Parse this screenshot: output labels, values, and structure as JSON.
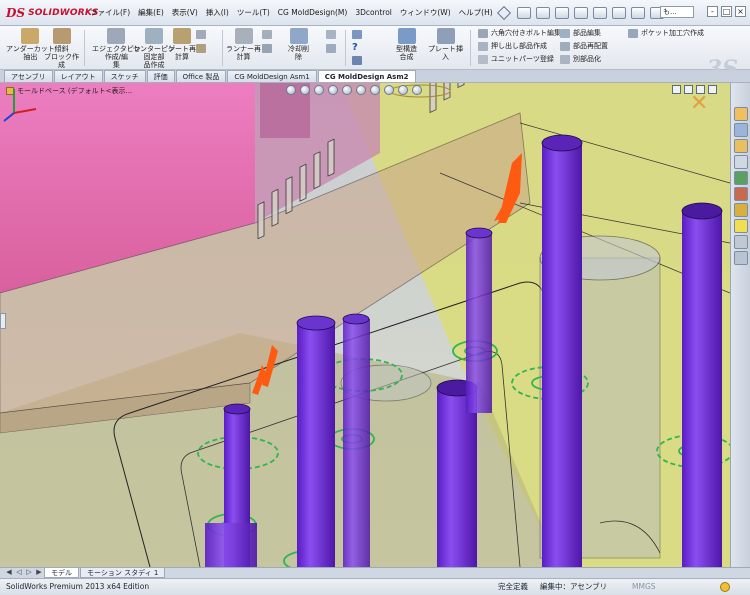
{
  "app": {
    "logo_mark": "DS",
    "logo_text": "SOLIDWORKS"
  },
  "menu": {
    "items": [
      "ファイル(F)",
      "編集(E)",
      "表示(V)",
      "挿入(I)",
      "ツール(T)",
      "CG MoldDesign(M)",
      "3Dcontrol",
      "ウィンドウ(W)",
      "ヘルプ(H)"
    ],
    "search_text": "も..."
  },
  "ribbon": {
    "buttons": [
      {
        "label": "アンダーカット\n抽出",
        "icon": "undercut-icon",
        "color": "#c9a86a"
      },
      {
        "label": "傾斜\nブロック作\n成",
        "icon": "slope-block-icon",
        "color": "#b89a70"
      },
      {
        "label": "エジェクタピン\n作成/編\n集",
        "icon": "ejector-pin-icon",
        "color": "#9fa8b8"
      },
      {
        "label": "センターピン\n固定部\n品作成",
        "icon": "center-pin-icon",
        "color": "#9fb0c0"
      },
      {
        "label": "ゲート再\n計算",
        "icon": "gate-recalc-icon",
        "color": "#b8a070"
      },
      {
        "label": "ランナー再\n計算",
        "icon": "runner-recalc-icon",
        "color": "#a8b0bc"
      },
      {
        "label": "冷却削\n除",
        "icon": "cooling-delete-icon",
        "color": "#8fa8c8"
      },
      {
        "label": "型構造\n合成",
        "icon": "mold-structure-icon",
        "color": "#7a9ac8"
      },
      {
        "label": "プレート挿\n入",
        "icon": "plate-insert-icon",
        "color": "#8ea0b8"
      }
    ],
    "small_items": [
      {
        "label": "六角穴付きボルト編集",
        "icon": "hex-bolt-icon"
      },
      {
        "label": "押し出し部品作成",
        "icon": "extrude-part-icon"
      },
      {
        "label": "ユニットパーツ登録",
        "icon": "unit-parts-icon"
      },
      {
        "label": "部品編集",
        "icon": "part-edit-icon"
      },
      {
        "label": "部品再配置",
        "icon": "part-relocate-icon"
      },
      {
        "label": "別部品化",
        "icon": "separate-part-icon"
      },
      {
        "label": "ポケット加工穴作成",
        "icon": "pocket-hole-icon"
      }
    ]
  },
  "cm_tabs": [
    "アセンブリ",
    "レイアウト",
    "スケッチ",
    "評価",
    "Office 製品",
    "CG MoldDesign Asm1",
    "CG MoldDesign Asm2"
  ],
  "active_tab": "CG MoldDesign Asm2",
  "tree": {
    "root_label": "モールドベース (デフォルト<表示..."
  },
  "bottom_tabs": [
    "モデル",
    "モーション スタディ 1"
  ],
  "status": {
    "edition": "SolidWorks Premium 2013 x64 Edition",
    "definition": "完全定義",
    "editing": "編集中：アセンブリ",
    "units": "MMGS"
  },
  "colors": {
    "pink_block": "#e66fb4",
    "pins": "#7a35e0",
    "slider_marks": "#ff5a12",
    "rings": "#32b452",
    "viewport_bg": "#c9cdd1"
  }
}
